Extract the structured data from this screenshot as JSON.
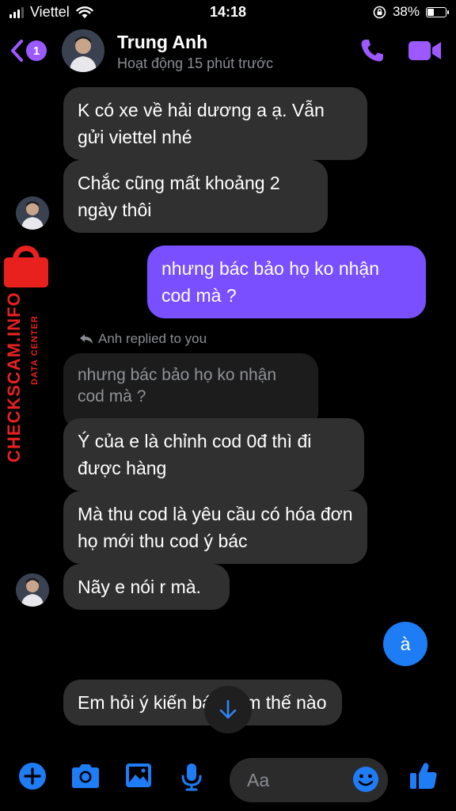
{
  "status_bar": {
    "carrier": "Viettel",
    "time": "14:18",
    "battery": "38%",
    "battery_level": 0.38
  },
  "header": {
    "back_badge": "1",
    "name": "Trung Anh",
    "status": "Hoạt động 15 phút trước"
  },
  "messages": {
    "m1": "K có xe về hải dương a ạ. Vẫn gửi viettel nhé",
    "m2": "Chắc cũng mất khoảng 2 ngày thôi",
    "m3": "nhưng bác bảo họ ko nhận cod mà ?",
    "reply_label": "Anh replied to you",
    "quoted": "nhưng bác bảo họ ko nhận cod mà ?",
    "m4": "Ý của e là chỉnh cod 0đ thì đi được hàng",
    "m5": "Mà thu cod là yêu cầu có hóa đơn họ mới thu cod ý bác",
    "m6": "Nãy e nói r mà.",
    "m7": "à",
    "m8": "Em hỏi ý kiến bác xem thế nào"
  },
  "watermark": {
    "main": "CHECKSCAM.INFO",
    "sub": "DATA CENTER"
  },
  "composer": {
    "placeholder": "Aa"
  },
  "colors": {
    "accent": "#9b59ff",
    "outgoing": "#7a4fff",
    "blue": "#1e7cf5",
    "incoming": "#303030",
    "watermark": "#e8211f"
  },
  "icons": [
    "chevron-left-icon",
    "phone-icon",
    "video-camera-icon",
    "reply-arrow-icon",
    "arrow-down-icon",
    "plus-icon",
    "camera-icon",
    "image-icon",
    "microphone-icon",
    "emoji-icon",
    "thumbs-up-icon",
    "wifi-icon",
    "lock-rotation-icon",
    "battery-icon",
    "signal-icon"
  ]
}
